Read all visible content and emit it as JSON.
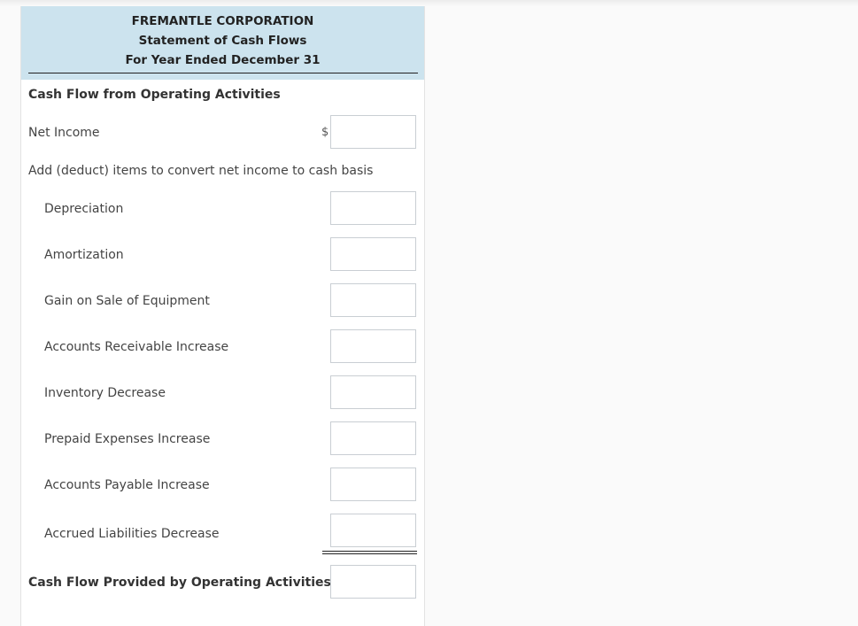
{
  "header": {
    "company": "FREMANTLE CORPORATION",
    "statement": "Statement of Cash Flows",
    "period": "For Year Ended December 31"
  },
  "section_title": "Cash Flow from Operating Activities",
  "net_income": {
    "label": "Net Income",
    "currency_symbol": "$",
    "value": ""
  },
  "adjustments_label": "Add (deduct) items to convert net income to cash basis",
  "adjustments": [
    {
      "label": "Depreciation",
      "value": ""
    },
    {
      "label": "Amortization",
      "value": ""
    },
    {
      "label": "Gain on Sale of Equipment",
      "value": ""
    },
    {
      "label": "Accounts Receivable Increase",
      "value": ""
    },
    {
      "label": "Inventory Decrease",
      "value": ""
    },
    {
      "label": "Prepaid Expenses Increase",
      "value": ""
    },
    {
      "label": "Accounts Payable Increase",
      "value": ""
    },
    {
      "label": "Accrued Liabilities Decrease",
      "value": ""
    }
  ],
  "total": {
    "label": "Cash Flow Provided by Operating Activities",
    "value": ""
  },
  "colors": {
    "header_bg": "#cce3ee",
    "input_border": "#c9ced3"
  }
}
